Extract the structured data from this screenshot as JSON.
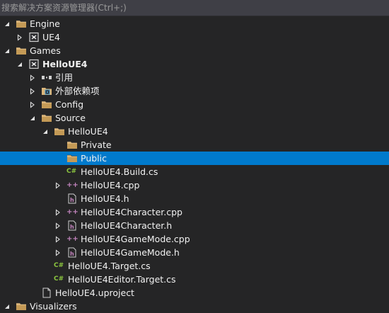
{
  "search": {
    "placeholder": "搜索解决方案资源管理器(Ctrl+;)"
  },
  "tree": {
    "items": [
      {
        "label": "Engine",
        "depth": 0,
        "expander": "expanded",
        "icon": "folder-icon"
      },
      {
        "label": "UE4",
        "depth": 1,
        "expander": "collapsed",
        "icon": "project-icon"
      },
      {
        "label": "Games",
        "depth": 0,
        "expander": "expanded",
        "icon": "folder-icon"
      },
      {
        "label": "HelloUE4",
        "depth": 1,
        "expander": "expanded",
        "icon": "project-icon",
        "bold": true
      },
      {
        "label": "引用",
        "depth": 2,
        "expander": "collapsed",
        "icon": "references-icon"
      },
      {
        "label": "外部依赖项",
        "depth": 2,
        "expander": "collapsed",
        "icon": "external-dependencies-icon"
      },
      {
        "label": "Config",
        "depth": 2,
        "expander": "collapsed",
        "icon": "folder-icon"
      },
      {
        "label": "Source",
        "depth": 2,
        "expander": "expanded",
        "icon": "folder-icon"
      },
      {
        "label": "HelloUE4",
        "depth": 3,
        "expander": "expanded",
        "icon": "folder-icon"
      },
      {
        "label": "Private",
        "depth": 4,
        "expander": "none",
        "icon": "folder-icon"
      },
      {
        "label": "Public",
        "depth": 4,
        "expander": "none",
        "icon": "folder-icon",
        "selected": true
      },
      {
        "label": "HelloUE4.Build.cs",
        "depth": 4,
        "expander": "none",
        "icon": "csharp-file-icon"
      },
      {
        "label": "HelloUE4.cpp",
        "depth": 4,
        "expander": "collapsed",
        "icon": "cpp-file-icon"
      },
      {
        "label": "HelloUE4.h",
        "depth": 4,
        "expander": "none",
        "icon": "header-file-icon"
      },
      {
        "label": "HelloUE4Character.cpp",
        "depth": 4,
        "expander": "collapsed",
        "icon": "cpp-file-icon"
      },
      {
        "label": "HelloUE4Character.h",
        "depth": 4,
        "expander": "collapsed",
        "icon": "header-file-icon"
      },
      {
        "label": "HelloUE4GameMode.cpp",
        "depth": 4,
        "expander": "collapsed",
        "icon": "cpp-file-icon"
      },
      {
        "label": "HelloUE4GameMode.h",
        "depth": 4,
        "expander": "collapsed",
        "icon": "header-file-icon"
      },
      {
        "label": "HelloUE4.Target.cs",
        "depth": 3,
        "expander": "none",
        "icon": "csharp-file-icon"
      },
      {
        "label": "HelloUE4Editor.Target.cs",
        "depth": 3,
        "expander": "none",
        "icon": "csharp-file-icon"
      },
      {
        "label": "HelloUE4.uproject",
        "depth": 2,
        "expander": "none",
        "icon": "file-icon"
      },
      {
        "label": "Visualizers",
        "depth": 0,
        "expander": "expanded",
        "icon": "folder-icon"
      }
    ]
  },
  "colors": {
    "background": "#252526",
    "selection": "#007acc",
    "text": "#f1f1f1",
    "folder": "#dcb67a",
    "csharp": "#8cc63f",
    "cpp": "#c586c0"
  }
}
